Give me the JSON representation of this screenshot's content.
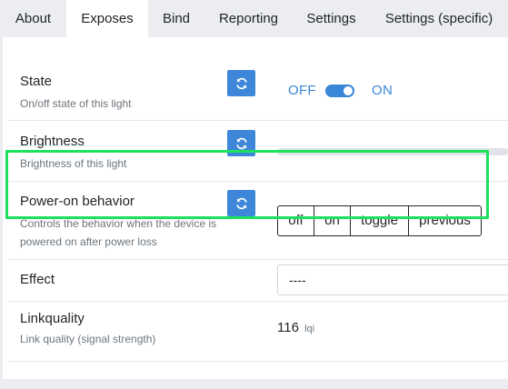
{
  "tabs": [
    {
      "label": "About"
    },
    {
      "label": "Exposes"
    },
    {
      "label": "Bind"
    },
    {
      "label": "Reporting"
    },
    {
      "label": "Settings"
    },
    {
      "label": "Settings (specific)"
    }
  ],
  "active_tab": "Exposes",
  "rows": {
    "state": {
      "title": "State",
      "description": "On/off state of this light",
      "off_label": "OFF",
      "on_label": "ON",
      "value": "ON"
    },
    "brightness": {
      "title": "Brightness",
      "description": "Brightness of this light"
    },
    "power_on": {
      "title": "Power-on behavior",
      "description": "Controls the behavior when the device is powered on after power loss",
      "options": [
        "off",
        "on",
        "toggle",
        "previous"
      ]
    },
    "effect": {
      "title": "Effect",
      "selected": "----"
    },
    "linkquality": {
      "title": "Linkquality",
      "description": "Link quality (signal strength)",
      "value": "116",
      "unit": "lqi"
    }
  },
  "colors": {
    "accent": "#3a86d8",
    "highlight": "#1ee05f"
  }
}
